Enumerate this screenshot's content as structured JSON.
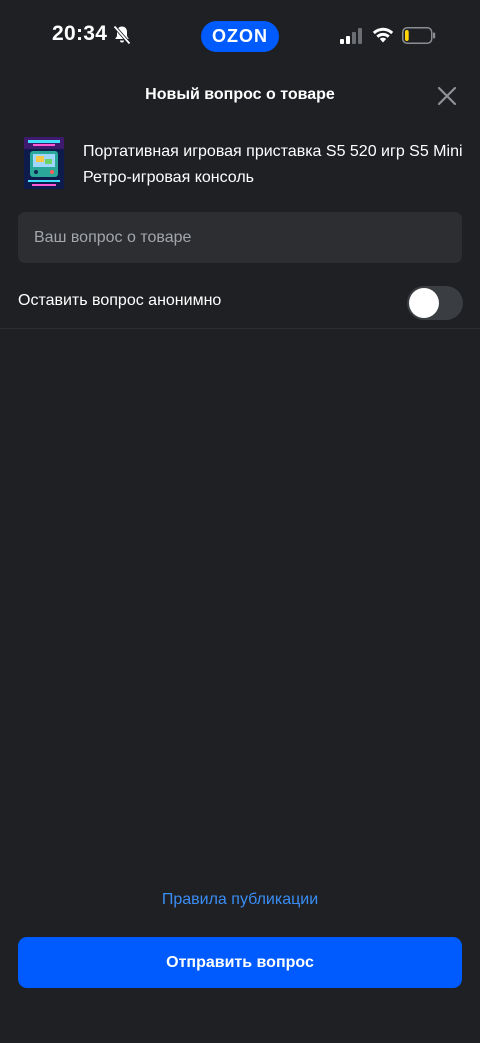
{
  "status_bar": {
    "time": "20:34",
    "brand": "OZON",
    "icons": [
      "bell-slash-icon",
      "signal-icon",
      "wifi-icon",
      "battery-icon"
    ],
    "battery_level": 0.15
  },
  "header": {
    "title": "Новый вопрос о товаре",
    "close_icon": "close-icon"
  },
  "product": {
    "title": "Портативная игровая приставка S5 520 игр S5 Mini Ретро-игровая консоль"
  },
  "question_field": {
    "value": "",
    "placeholder": "Ваш вопрос о товаре"
  },
  "anonymous": {
    "label": "Оставить вопрос анонимно",
    "enabled": false
  },
  "footer": {
    "rules_link": "Правила публикации",
    "submit_label": "Отправить вопрос"
  },
  "colors": {
    "background": "#1e2024",
    "field": "#2c2e32",
    "accent": "#005bff",
    "link": "#3a8df5"
  }
}
